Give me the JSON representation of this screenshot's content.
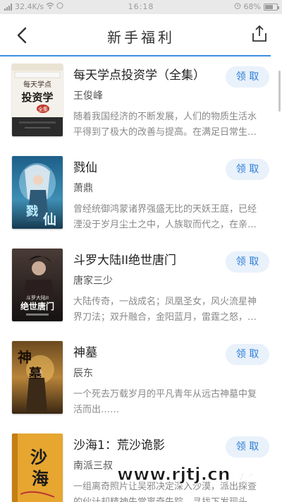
{
  "status_bar": {
    "network_speed": "32.4K/s",
    "time": "16:18",
    "battery": "68%",
    "battery_level": 0.68
  },
  "header": {
    "title": "新手福利",
    "accent_color": "#3a8fe0"
  },
  "books": [
    {
      "title": "每天学点投资学（全集）",
      "author": "王俊峰",
      "description": "随着我国经济的不断发展，人们的物质生活水平得到了极大的改善与提高。在满足日常生…",
      "claim_label": "领 取",
      "cover_lines": [
        "每天学点",
        "投资学",
        "全集"
      ]
    },
    {
      "title": "戮仙",
      "author": "萧鼎",
      "description": "曾经统御鸿蒙诸界强盛无比的天妖王庭，已经湮没于岁月尘土之中，人族取而代之，在亲…",
      "claim_label": "领 取",
      "cover_lines": [
        "戮",
        "仙"
      ]
    },
    {
      "title": "斗罗大陆II绝世唐门",
      "author": "唐家三少",
      "description": "大陆传奇，一战成名；凤凰圣女，风火流星神界刀法；双升融合，金阳蓝月，雷霆之怒，…",
      "claim_label": "领 取",
      "cover_lines": [
        "斗罗大陆II",
        "绝世唐门"
      ]
    },
    {
      "title": "神墓",
      "author": "辰东",
      "description": "一个死去万载岁月的平凡青年从远古神墓中复活而出……",
      "claim_label": "领 取",
      "cover_lines": [
        "神",
        "墓"
      ]
    },
    {
      "title": "沙海1：荒沙诡影",
      "author": "南派三叔",
      "description": "一组离奇照片让吴邪决定深入沙漠，派出探查的伙计却精神失常离奇失踪。寻找下发现头…",
      "claim_label": "领 取",
      "cover_lines": [
        "沙",
        "海"
      ]
    }
  ],
  "watermark": "www.rjtj.cn软荐网"
}
